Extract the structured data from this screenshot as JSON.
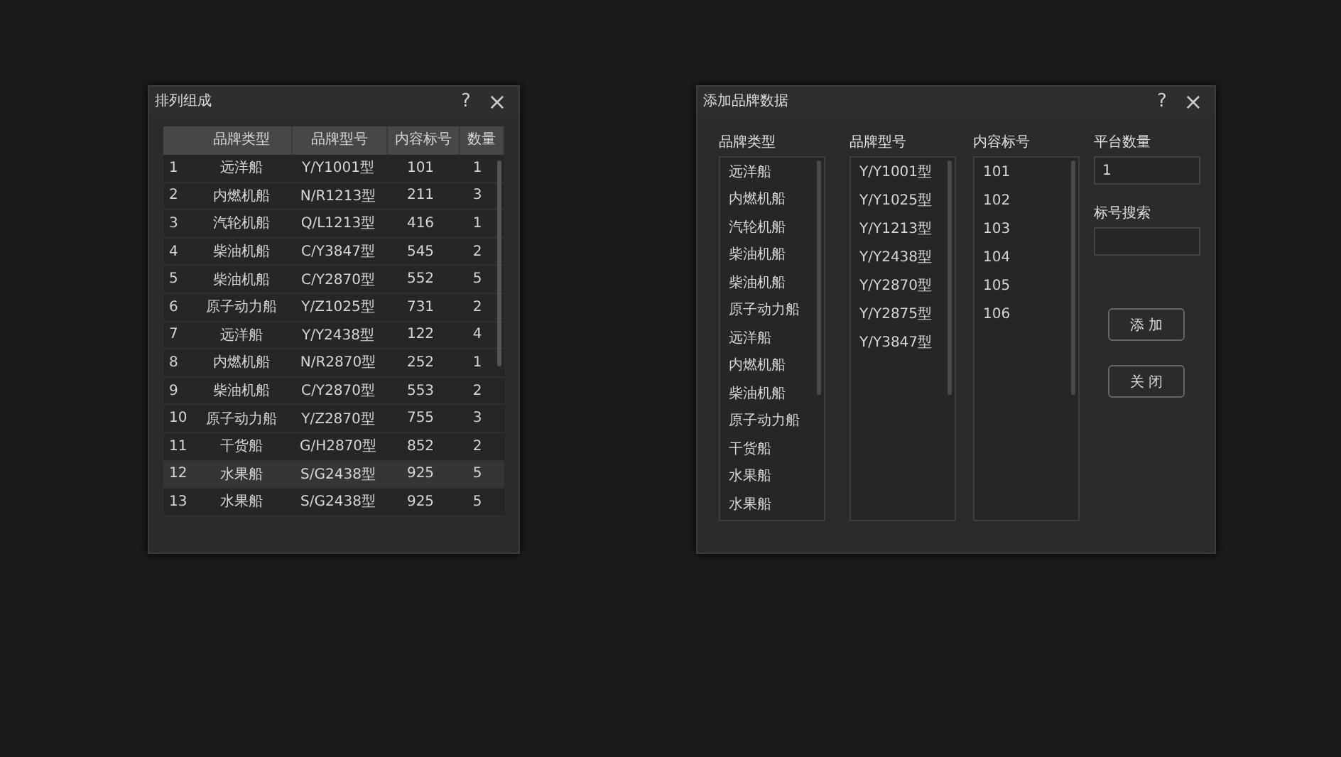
{
  "arrange_dialog": {
    "title": "排列组成",
    "help": "?",
    "close": "×",
    "table": {
      "columns": [
        "",
        "品牌类型",
        "品牌型号",
        "内容标号",
        "数量"
      ],
      "rows": [
        {
          "cells": [
            "1",
            "远洋船",
            "Y/Y1001型",
            "101",
            "1"
          ],
          "selected": false
        },
        {
          "cells": [
            "2",
            "内燃机船",
            "N/R1213型",
            "211",
            "3"
          ],
          "selected": false
        },
        {
          "cells": [
            "3",
            "汽轮机船",
            "Q/L1213型",
            "416",
            "1"
          ],
          "selected": false
        },
        {
          "cells": [
            "4",
            "柴油机船",
            "C/Y3847型",
            "545",
            "2"
          ],
          "selected": false
        },
        {
          "cells": [
            "5",
            "柴油机船",
            "C/Y2870型",
            "552",
            "5"
          ],
          "selected": false
        },
        {
          "cells": [
            "6",
            "原子动力船",
            "Y/Z1025型",
            "731",
            "2"
          ],
          "selected": false
        },
        {
          "cells": [
            "7",
            "远洋船",
            "Y/Y2438型",
            "122",
            "4"
          ],
          "selected": false
        },
        {
          "cells": [
            "8",
            "内燃机船",
            "N/R2870型",
            "252",
            "1"
          ],
          "selected": false
        },
        {
          "cells": [
            "9",
            "柴油机船",
            "C/Y2870型",
            "553",
            "2"
          ],
          "selected": false
        },
        {
          "cells": [
            "10",
            "原子动力船",
            "Y/Z2870型",
            "755",
            "3"
          ],
          "selected": false
        },
        {
          "cells": [
            "11",
            "干货船",
            "G/H2870型",
            "852",
            "2"
          ],
          "selected": false
        },
        {
          "cells": [
            "12",
            "水果船",
            "S/G2438型",
            "925",
            "5"
          ],
          "selected": true
        },
        {
          "cells": [
            "13",
            "水果船",
            "S/G2438型",
            "925",
            "5"
          ],
          "selected": false
        }
      ]
    }
  },
  "add_dialog": {
    "title": "添加品牌数据",
    "help": "?",
    "close": "×",
    "lists": [
      {
        "label": "品牌类型",
        "items": [
          "远洋船",
          "内燃机船",
          "汽轮机船",
          "柴油机船",
          "柴油机船",
          "原子动力船",
          "远洋船",
          "内燃机船",
          "柴油机船",
          "原子动力船",
          "干货船",
          "水果船",
          "水果船"
        ]
      },
      {
        "label": "品牌型号",
        "items": [
          "Y/Y1001型",
          "Y/Y1025型",
          "Y/Y1213型",
          "Y/Y2438型",
          "Y/Y2870型",
          "Y/Y2875型",
          "Y/Y3847型"
        ]
      },
      {
        "label": "内容标号",
        "items": [
          "101",
          "102",
          "103",
          "104",
          "105",
          "106"
        ]
      }
    ],
    "fields": [
      {
        "label": "平台数量",
        "value": "1"
      },
      {
        "label": "标号搜索"
      }
    ],
    "buttons": [
      "添 加",
      "关 闭"
    ]
  }
}
